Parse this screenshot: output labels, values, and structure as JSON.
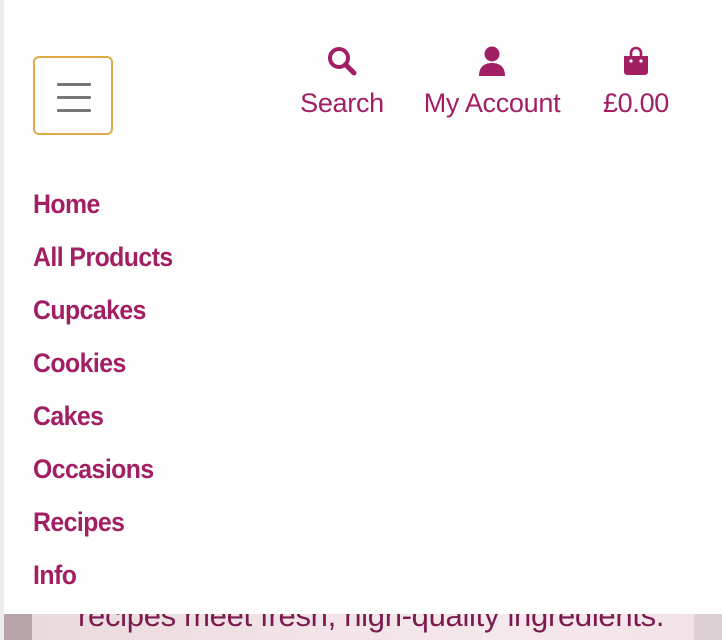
{
  "header": {
    "menu_label": "Menu",
    "actions": [
      {
        "icon": "search-icon",
        "label": "Search"
      },
      {
        "icon": "user-icon",
        "label": "My Account"
      },
      {
        "icon": "shopping-bag-icon",
        "label": "£0.00"
      }
    ]
  },
  "nav": {
    "items": [
      {
        "label": "Home"
      },
      {
        "label": "All Products"
      },
      {
        "label": "Cupcakes"
      },
      {
        "label": "Cookies"
      },
      {
        "label": "Cakes"
      },
      {
        "label": "Occasions"
      },
      {
        "label": "Recipes"
      },
      {
        "label": "Info"
      }
    ]
  },
  "hero": {
    "text": "recipes meet fresh, high-quality ingredients."
  },
  "colors": {
    "brand": "#a21f63",
    "menu_button_border": "#e0a94a"
  }
}
